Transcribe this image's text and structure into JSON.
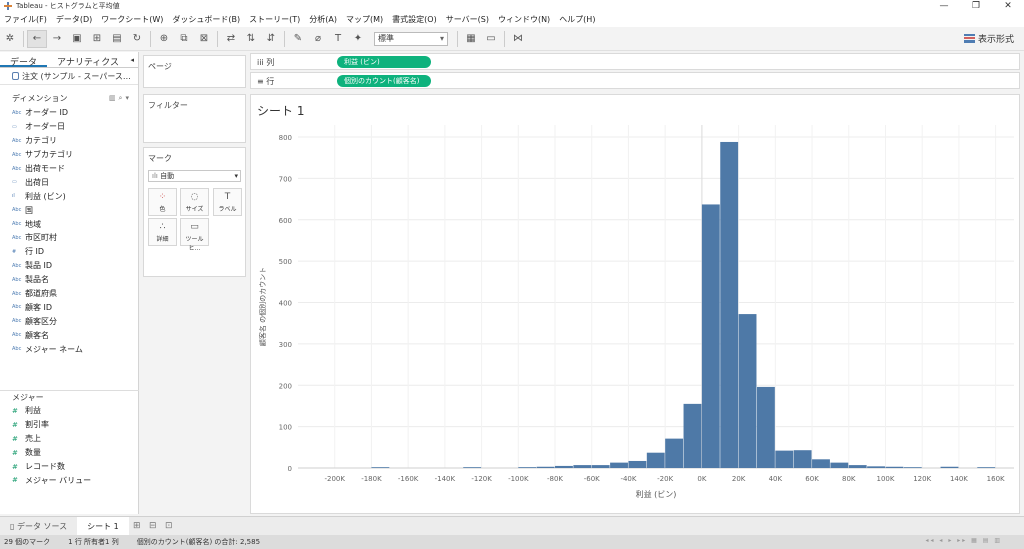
{
  "window": {
    "title": "Tableau - ヒストグラムと平均値",
    "min": "—",
    "max": "❐",
    "close": "✕"
  },
  "menu": [
    "ファイル(F)",
    "データ(D)",
    "ワークシート(W)",
    "ダッシュボード(B)",
    "ストーリー(T)",
    "分析(A)",
    "マップ(M)",
    "書式設定(O)",
    "サーバー(S)",
    "ウィンドウ(N)",
    "ヘルプ(H)"
  ],
  "toolbar": {
    "fit_value": "標準",
    "show_me": "表示形式"
  },
  "data_pane": {
    "tab_data": "データ",
    "tab_analytics": "アナリティクス",
    "source": "注文 (サンプル - スーパース…",
    "dimensions_header": "ディメンション",
    "dimensions": [
      {
        "type": "Abc",
        "name": "オーダー ID"
      },
      {
        "type": "date",
        "name": "オーダー日"
      },
      {
        "type": "Abc",
        "name": "カテゴリ"
      },
      {
        "type": "Abc",
        "name": "サブカテゴリ"
      },
      {
        "type": "Abc",
        "name": "出荷モード"
      },
      {
        "type": "date",
        "name": "出荷日"
      },
      {
        "type": "bin",
        "name": "利益 (ビン)"
      },
      {
        "type": "Abc",
        "name": "国"
      },
      {
        "type": "Abc",
        "name": "地域"
      },
      {
        "type": "Abc",
        "name": "市区町村"
      },
      {
        "type": "num",
        "name": "行 ID"
      },
      {
        "type": "Abc",
        "name": "製品 ID"
      },
      {
        "type": "Abc",
        "name": "製品名"
      },
      {
        "type": "Abc",
        "name": "都道府県"
      },
      {
        "type": "Abc",
        "name": "顧客 ID"
      },
      {
        "type": "Abc",
        "name": "顧客区分"
      },
      {
        "type": "Abc",
        "name": "顧客名"
      },
      {
        "type": "Abc",
        "name": "メジャー ネーム"
      }
    ],
    "measures_header": "メジャー",
    "measures": [
      "利益",
      "割引率",
      "売上",
      "数量",
      "レコード数",
      "メジャー バリュー"
    ]
  },
  "cards": {
    "pages": "ページ",
    "filters": "フィルター",
    "marks": "マーク",
    "mark_type": "自動",
    "mark_buttons": [
      "色",
      "サイズ",
      "ラベル",
      "詳細",
      "ツールヒ…"
    ]
  },
  "shelves": {
    "columns_label": "iii 列",
    "columns_pill": "利益 (ビン)",
    "rows_label": "≡ 行",
    "rows_pill": "個別のカウント(顧客名)"
  },
  "sheet": {
    "title": "シート 1"
  },
  "chart_data": {
    "type": "bar",
    "xlabel": "利益 (ビン)",
    "ylabel": "顧客名 の個別のカウント",
    "xlim": [
      -220000,
      170000
    ],
    "ylim": [
      0,
      800
    ],
    "y_ticks": [
      0,
      100,
      200,
      300,
      400,
      500,
      600,
      700,
      800
    ],
    "x_ticks": [
      -200000,
      -180000,
      -160000,
      -140000,
      -120000,
      -100000,
      -80000,
      -60000,
      -40000,
      -20000,
      0,
      20000,
      40000,
      60000,
      80000,
      100000,
      120000,
      140000,
      160000
    ],
    "x_tick_labels": [
      "-200K",
      "-180K",
      "-160K",
      "-140K",
      "-120K",
      "-100K",
      "-80K",
      "-60K",
      "-40K",
      "-20K",
      "0K",
      "20K",
      "40K",
      "60K",
      "80K",
      "100K",
      "120K",
      "140K",
      "160K"
    ],
    "bin_width": 10000,
    "bins": [
      {
        "start": -180000,
        "value": 1
      },
      {
        "start": -130000,
        "value": 1
      },
      {
        "start": -100000,
        "value": 2
      },
      {
        "start": -90000,
        "value": 3
      },
      {
        "start": -80000,
        "value": 5
      },
      {
        "start": -70000,
        "value": 7
      },
      {
        "start": -60000,
        "value": 7
      },
      {
        "start": -50000,
        "value": 13
      },
      {
        "start": -40000,
        "value": 17
      },
      {
        "start": -30000,
        "value": 37
      },
      {
        "start": -20000,
        "value": 71
      },
      {
        "start": -10000,
        "value": 155
      },
      {
        "start": 0,
        "value": 637
      },
      {
        "start": 10000,
        "value": 788
      },
      {
        "start": 20000,
        "value": 372
      },
      {
        "start": 30000,
        "value": 196
      },
      {
        "start": 40000,
        "value": 42
      },
      {
        "start": 50000,
        "value": 43
      },
      {
        "start": 60000,
        "value": 21
      },
      {
        "start": 70000,
        "value": 13
      },
      {
        "start": 80000,
        "value": 7
      },
      {
        "start": 90000,
        "value": 4
      },
      {
        "start": 100000,
        "value": 3
      },
      {
        "start": 110000,
        "value": 1
      },
      {
        "start": 130000,
        "value": 3
      },
      {
        "start": 150000,
        "value": 1
      }
    ],
    "bar_color": "#4e79a7",
    "grid": true
  },
  "sheet_tabs": {
    "data_source": "データ ソース",
    "sheet": "シート 1"
  },
  "status": {
    "marks": "29 個のマーク",
    "dims": "1 行 所有者1 列",
    "sum": "個別のカウント(顧客名) の合計: 2,585"
  }
}
